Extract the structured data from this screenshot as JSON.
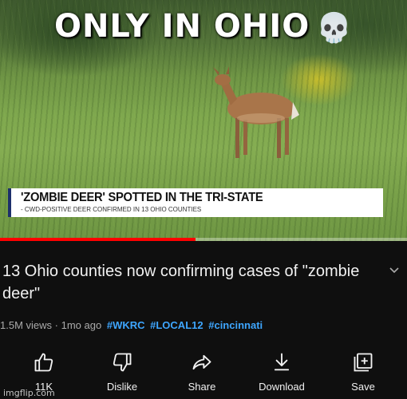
{
  "overlay": {
    "caption": "ONLY IN OHIO",
    "caption_emoji": "💀",
    "lower_third_headline": "'ZOMBIE DEER' SPOTTED IN THE TRI-STATE",
    "lower_third_subline": "- CWD-POSITIVE DEER CONFIRMED IN 13 OHIO COUNTIES"
  },
  "player": {
    "progress": 0.48,
    "progress_color": "#ff0000"
  },
  "video": {
    "title": "13 Ohio counties now confirming cases of \"zombie deer\"",
    "views": "1.5M views",
    "age": "1mo ago",
    "hashtags": [
      "#WKRC",
      "#LOCAL12",
      "#cincinnati"
    ],
    "hashtag_color": "#3ea6ff"
  },
  "actions": [
    {
      "icon": "thumbs-up-icon",
      "label": "11K"
    },
    {
      "icon": "thumbs-down-icon",
      "label": "Dislike"
    },
    {
      "icon": "share-icon",
      "label": "Share"
    },
    {
      "icon": "download-icon",
      "label": "Download"
    },
    {
      "icon": "save-icon",
      "label": "Save"
    }
  ],
  "watermark": "imgflip.com"
}
